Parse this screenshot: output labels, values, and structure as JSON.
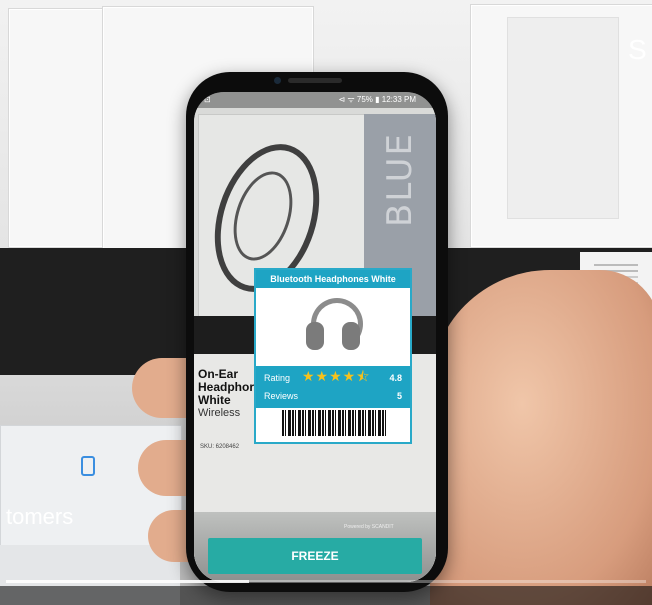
{
  "video": {
    "caption_text": "tomers",
    "brand_partial": "SC",
    "progress_fraction": 0.38
  },
  "phone": {
    "status_left": "⊡",
    "status_right": "⊲ ᯤ 75% ▮ 12:33 PM",
    "camera_view": {
      "box_side_text": "BLUE",
      "product_line1": "On-Ear",
      "product_line2": "Headphor",
      "product_line3": "White",
      "product_line4": "Wireless",
      "sku": "SKU: 6208462",
      "powered_by": "Powered by SCANDIT"
    },
    "ar_card": {
      "title": "Bluetooth Headphones White",
      "rating_label": "Rating",
      "rating_stars": "★★★★⯪",
      "rating_value": "4.8",
      "reviews_label": "Reviews",
      "reviews_value": "5"
    },
    "freeze_button": "FREEZE"
  },
  "colors": {
    "accent": "#1ea4c4",
    "freeze": "#27aba4",
    "stars": "#f6c21c"
  }
}
